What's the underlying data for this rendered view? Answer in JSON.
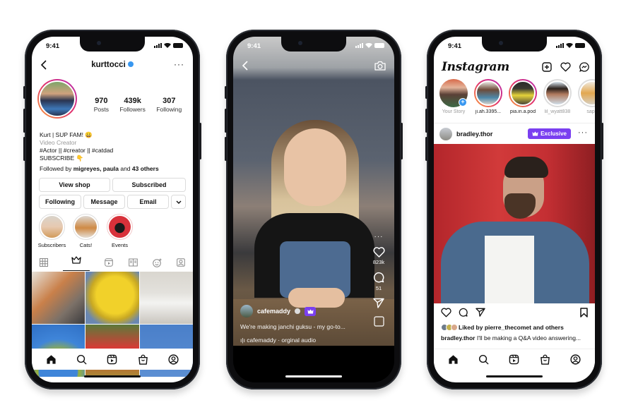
{
  "status_time": "9:41",
  "profile_screen": {
    "username": "kurttocci",
    "verified": true,
    "stats": [
      {
        "value": "970",
        "label": "Posts"
      },
      {
        "value": "439k",
        "label": "Followers"
      },
      {
        "value": "307",
        "label": "Following"
      }
    ],
    "bio": {
      "name_line": "Kurt | SUP FAM! 😀",
      "category": "Video Creator",
      "tags": "#Actor || #creator || #catdad",
      "cta": "SUBSCRIBE 👇"
    },
    "followed_by": {
      "prefix": "Followed by ",
      "names": "migreyes, paula",
      "middle": " and ",
      "others": "43 others"
    },
    "buttons": {
      "view_shop": "View shop",
      "subscribed": "Subscribed",
      "following": "Following",
      "message": "Message",
      "email": "Email",
      "more": "⌄"
    },
    "highlights": [
      {
        "label": "Subscribers"
      },
      {
        "label": "Cats!"
      },
      {
        "label": "Events"
      }
    ],
    "content_tabs": [
      "grid-icon",
      "crown-icon",
      "reels-icon",
      "guides-icon",
      "effects-icon",
      "tagged-icon"
    ],
    "active_tab": "crown-icon"
  },
  "reel_screen": {
    "likes": "823k",
    "comments": "51",
    "username": "cafemaddy",
    "caption": "We're making janchi guksu - my go-to...",
    "audio": "cafemaddy · orginal audio",
    "more": "···"
  },
  "feed_screen": {
    "logo": "Instagram",
    "stories": [
      {
        "label": "Your Story",
        "own": true
      },
      {
        "label": "ji.ah.3395...",
        "own": false
      },
      {
        "label": "pia.in.a.pod",
        "own": false
      },
      {
        "label": "lil_wyatt838",
        "own": false
      },
      {
        "label": "sapp",
        "own": false
      }
    ],
    "post": {
      "username": "bradley.thor",
      "badge": "Exclusive",
      "more": "···",
      "liked_by": "Liked by pierre_thecomet and others",
      "caption_user": "bradley.thor",
      "caption_text": " I'll be making a Q&A video answering..."
    }
  },
  "colors": {
    "accent_purple": "#7a3ff0",
    "verified_blue": "#3897f0",
    "story_gradient_start": "#f9a13a",
    "story_gradient_end": "#b52db2"
  }
}
